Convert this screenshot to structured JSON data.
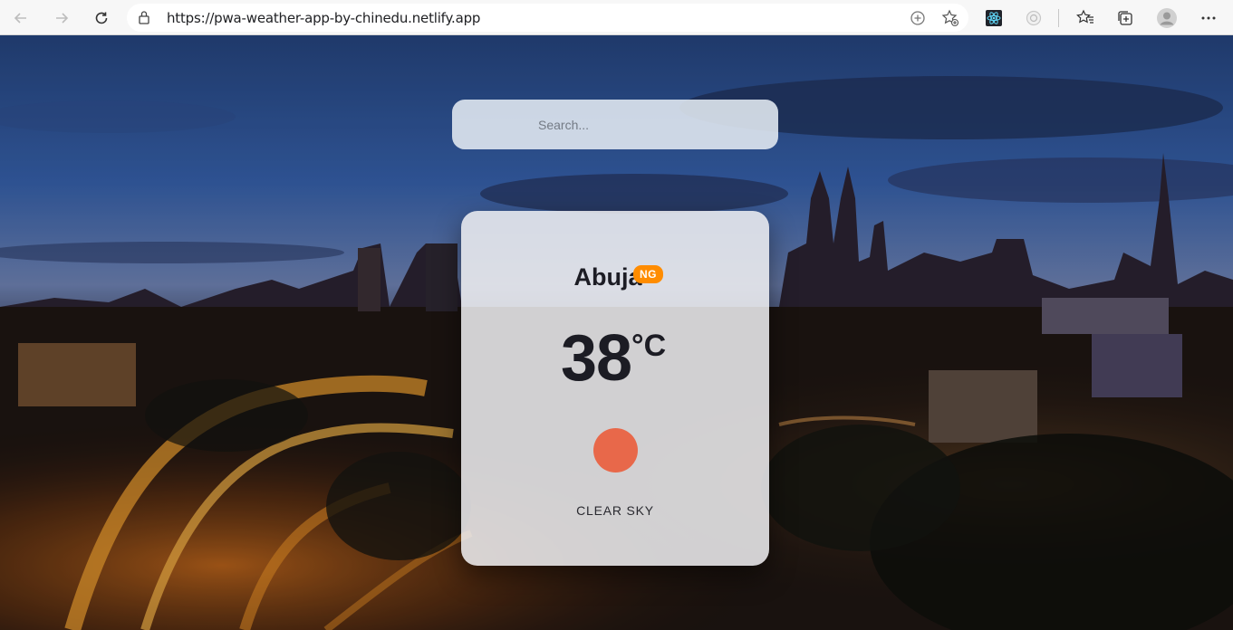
{
  "browser": {
    "url": "https://pwa-weather-app-by-chinedu.netlify.app"
  },
  "search": {
    "placeholder": "Search..."
  },
  "weather": {
    "city": "Abuja",
    "country": "NG",
    "temperature": "38",
    "unit": "°C",
    "description": "CLEAR SKY",
    "icon": "sun-icon",
    "icon_color": "#e8684a",
    "badge_color": "#ff8c00"
  }
}
